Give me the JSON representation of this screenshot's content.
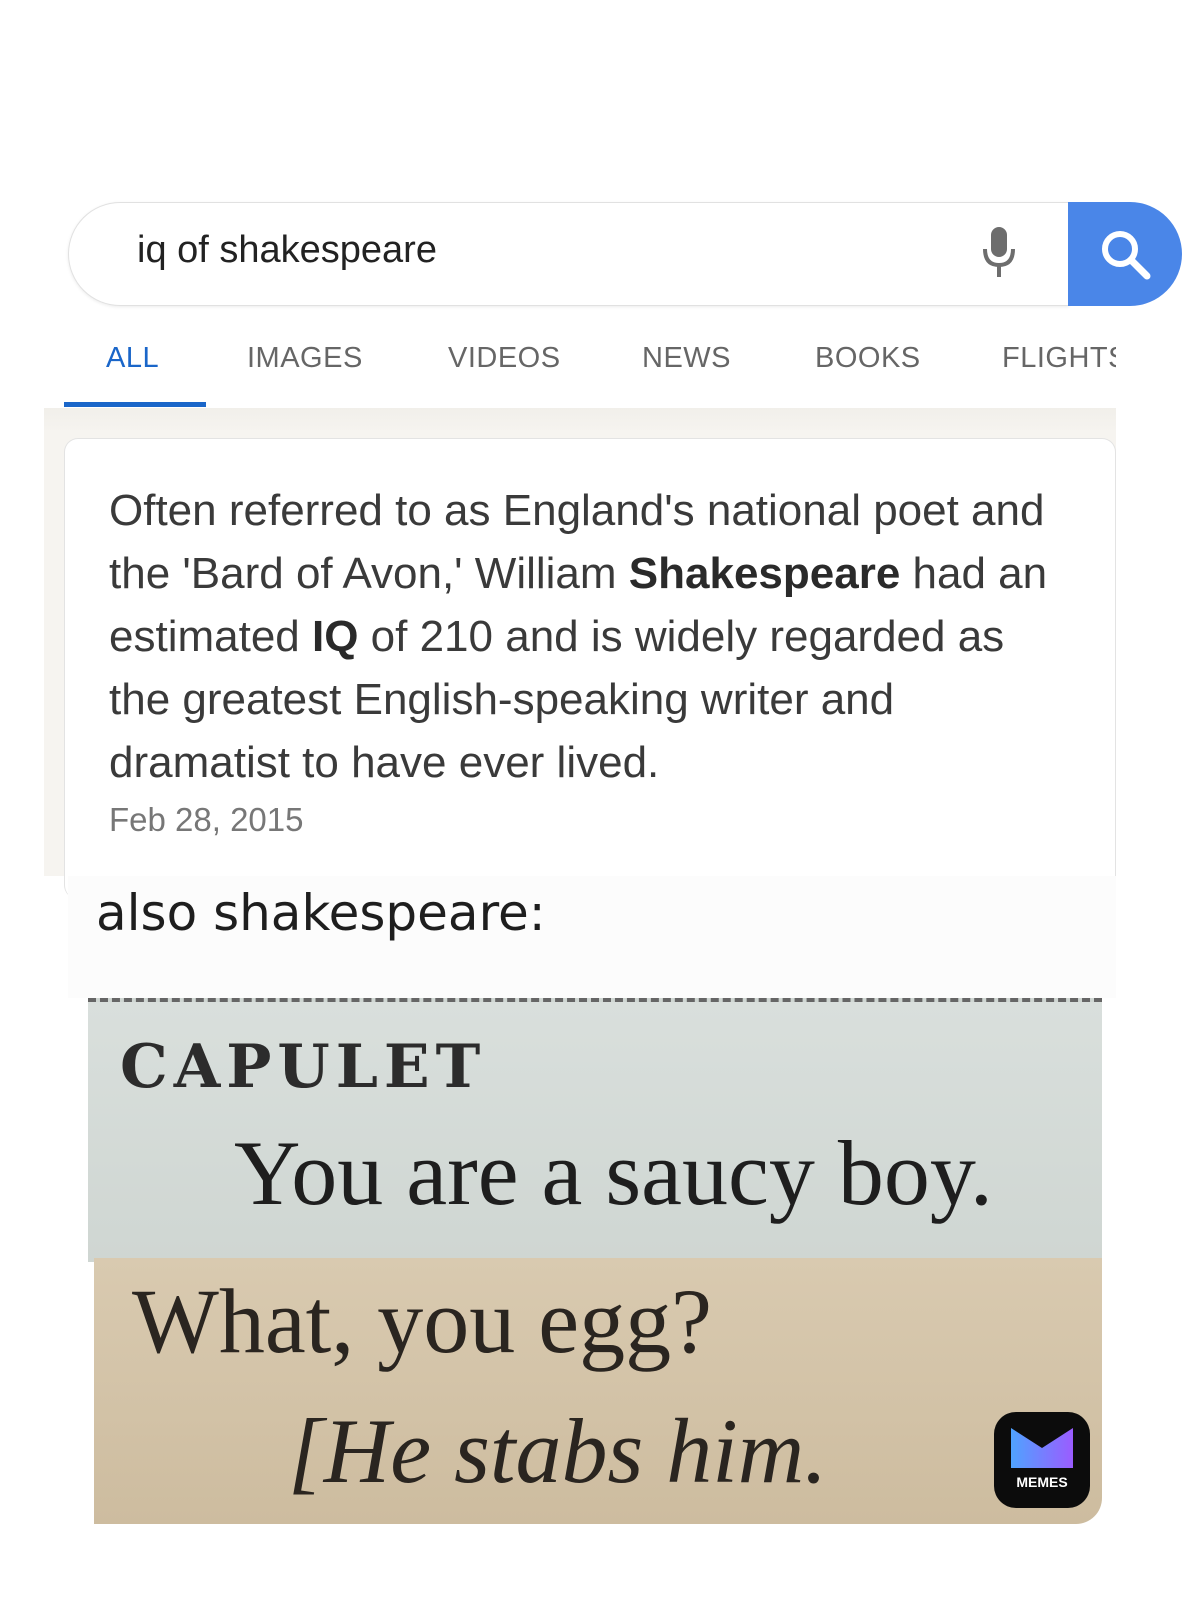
{
  "search": {
    "query": "iq of shakespeare",
    "mic_icon": "microphone-icon",
    "button_icon": "search-icon",
    "accent_color": "#4a86e8"
  },
  "tabs": [
    {
      "label": "ALL",
      "active": true
    },
    {
      "label": "IMAGES",
      "active": false
    },
    {
      "label": "VIDEOS",
      "active": false
    },
    {
      "label": "NEWS",
      "active": false
    },
    {
      "label": "BOOKS",
      "active": false
    },
    {
      "label": "FLIGHTS",
      "active": false
    }
  ],
  "snippet": {
    "text_1": "Often referred to as England's national poet and the 'Bard of Avon,' William ",
    "bold_1": "Shakespeare",
    "text_2": " had an estimated ",
    "bold_2": "IQ",
    "text_3": " of 210 and is widely regarded as the greatest English-speaking writer and dramatist to have ever lived.",
    "date": "Feb 28, 2015"
  },
  "meme": {
    "caption": "also shakespeare:",
    "panel1_name": "CAPULET",
    "panel1_line": "You are a saucy boy.",
    "panel2_line1": "What, you egg?",
    "panel2_line2": "[He stabs him."
  },
  "watermark": {
    "label": "MEMES"
  }
}
